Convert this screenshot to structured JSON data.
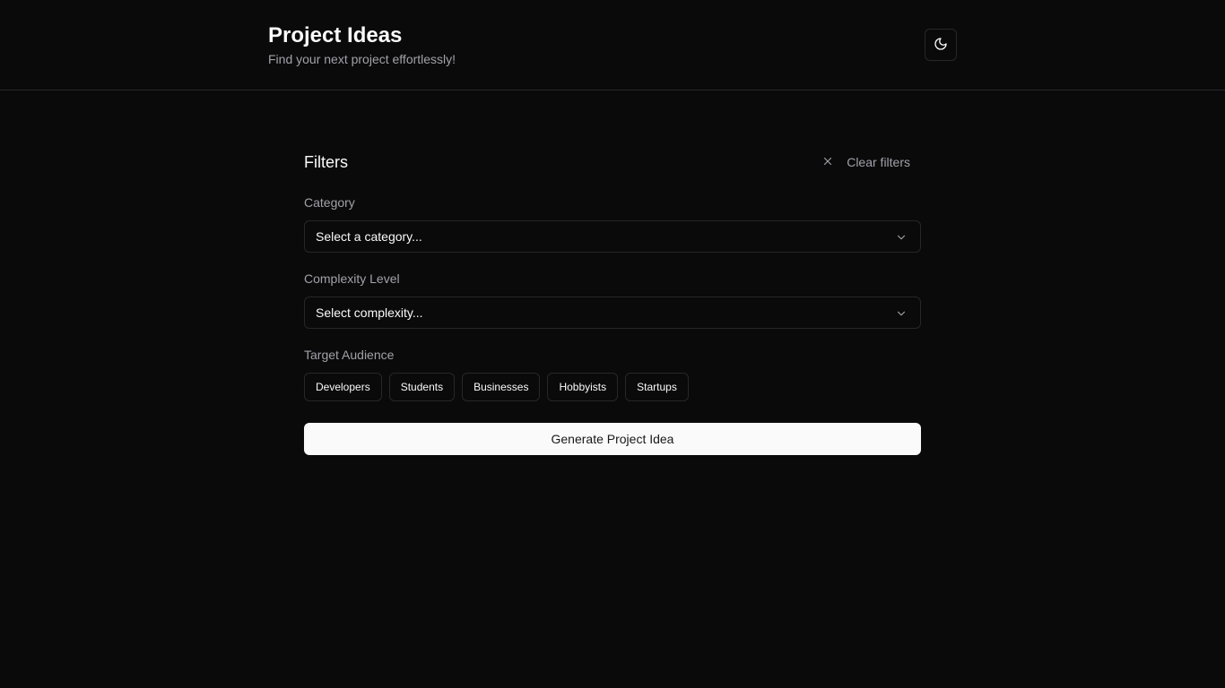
{
  "header": {
    "title": "Project Ideas",
    "subtitle": "Find your next project effortlessly!",
    "theme_toggle_icon": "moon-icon"
  },
  "filters": {
    "title": "Filters",
    "clear_label": "Clear filters",
    "clear_icon": "close-icon",
    "category": {
      "label": "Category",
      "value": "Select a category..."
    },
    "complexity": {
      "label": "Complexity Level",
      "value": "Select complexity..."
    },
    "audience": {
      "label": "Target Audience",
      "options": [
        "Developers",
        "Students",
        "Businesses",
        "Hobbyists",
        "Startups"
      ]
    },
    "generate_label": "Generate Project Idea"
  },
  "colors": {
    "background": "#0a0a0a",
    "border": "#27272a",
    "text": "#fafafa",
    "muted": "#a1a1aa",
    "primary_button": "#fafafa"
  }
}
